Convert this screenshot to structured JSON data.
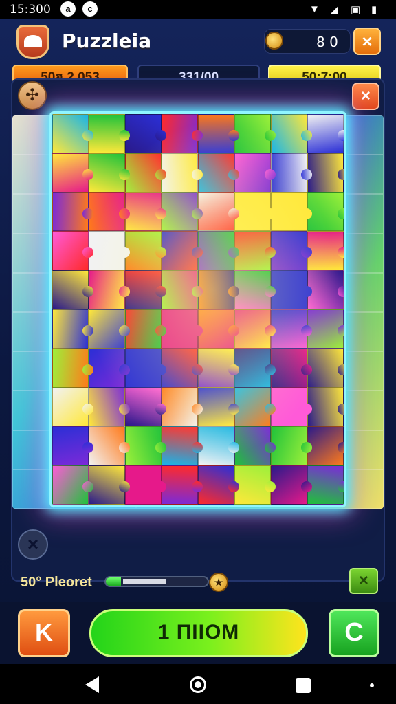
{
  "status_bar": {
    "time": "15:300",
    "notif_icons": [
      "a",
      "c"
    ]
  },
  "header": {
    "title": "Puzzleia",
    "coin_count": "8 0",
    "close_label": "×"
  },
  "stats": {
    "left": "50ฮ 2,053",
    "middle": "331/00",
    "right": "50:7;00"
  },
  "panel": {
    "close_label": "×",
    "tool_label": "✣"
  },
  "board": {
    "columns": 8,
    "rows": 10
  },
  "progress": {
    "label": "50° Pleoret",
    "fraction": 0.15,
    "coin_label": "★"
  },
  "hint_button_label": "×",
  "check_button_label": "×",
  "bottom": {
    "left_label": "K",
    "main_label": "1 ПIIOM",
    "right_label": "C"
  },
  "colors": {
    "accent_orange": "#ff9a1d",
    "accent_yellow": "#fff24a",
    "accent_green": "#23d41a",
    "glow_cyan": "#8ff5ff"
  }
}
